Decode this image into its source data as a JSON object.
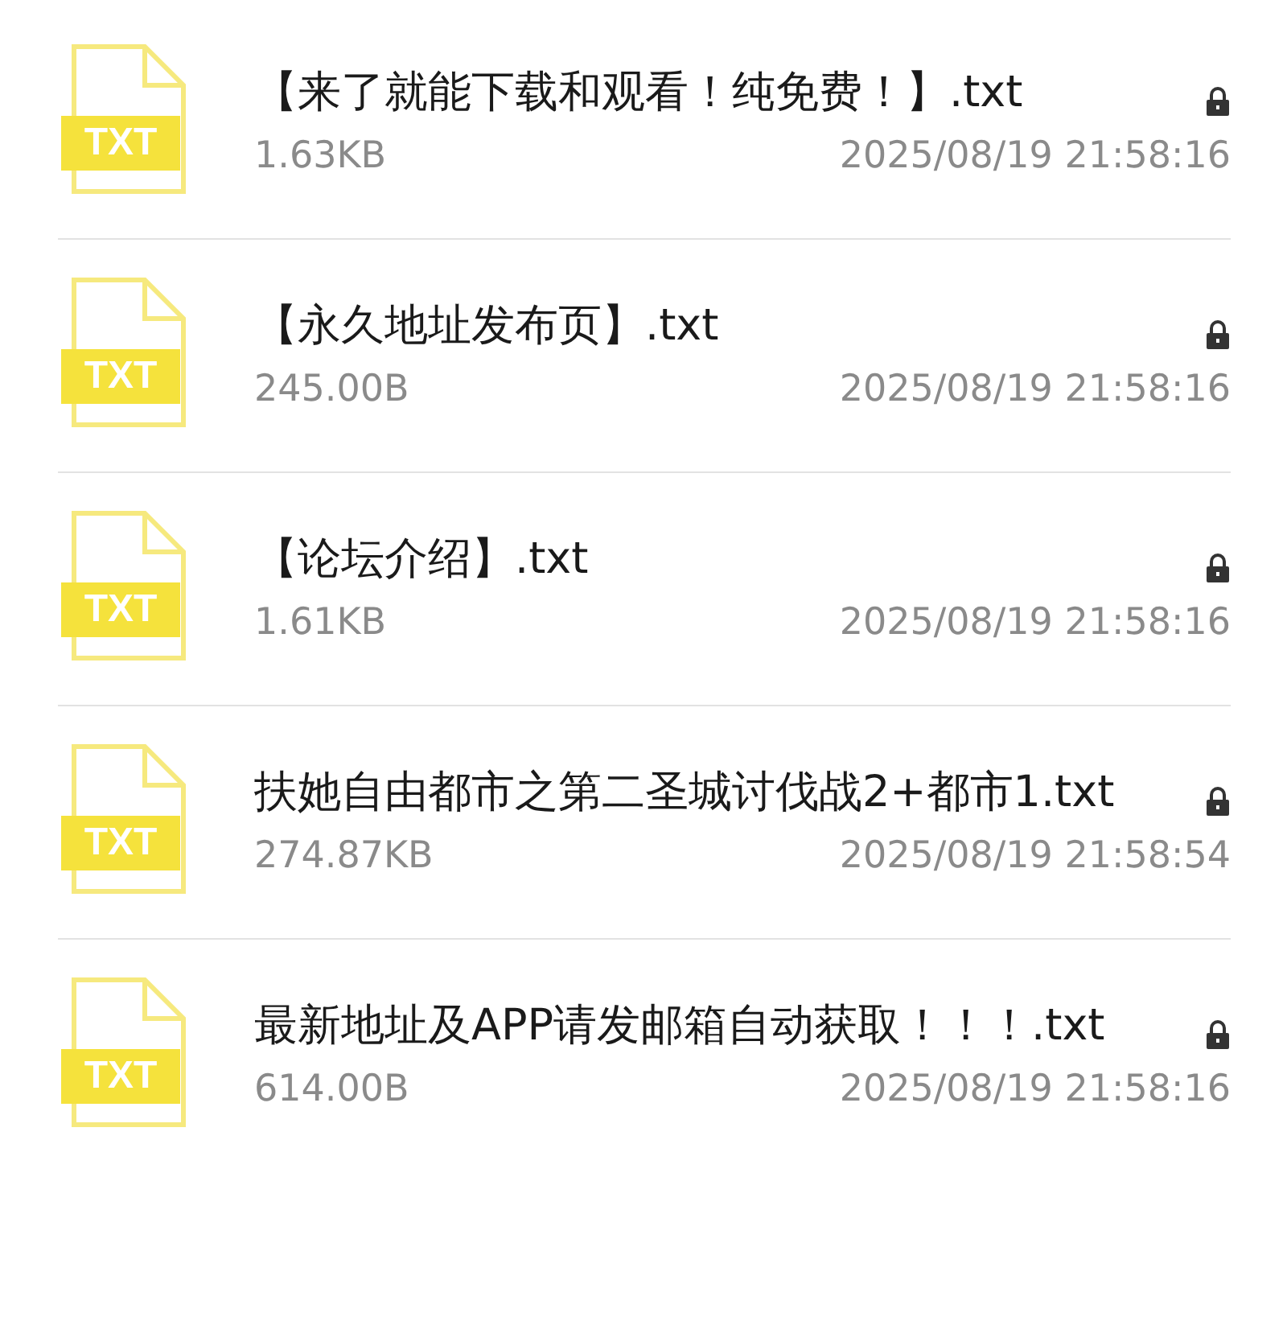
{
  "files": [
    {
      "icon_label": "TXT",
      "name": "【来了就能下载和观看！纯免费！】.txt",
      "size": "1.63KB",
      "modified": "2025/08/19 21:58:16",
      "locked": true
    },
    {
      "icon_label": "TXT",
      "name": "【永久地址发布页】.txt",
      "size": "245.00B",
      "modified": "2025/08/19 21:58:16",
      "locked": true
    },
    {
      "icon_label": "TXT",
      "name": "【论坛介绍】.txt",
      "size": "1.61KB",
      "modified": "2025/08/19 21:58:16",
      "locked": true
    },
    {
      "icon_label": "TXT",
      "name": "扶她自由都市之第二圣城讨伐战2+都市1.txt",
      "size": "274.87KB",
      "modified": "2025/08/19 21:58:54",
      "locked": true
    },
    {
      "icon_label": "TXT",
      "name": "最新地址及APP请发邮箱自动获取！！！.txt",
      "size": "614.00B",
      "modified": "2025/08/19 21:58:16",
      "locked": true
    }
  ]
}
